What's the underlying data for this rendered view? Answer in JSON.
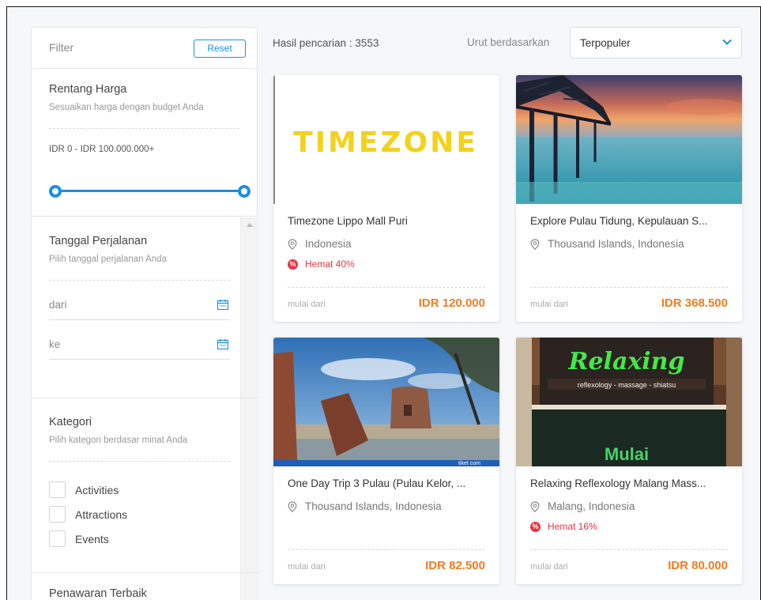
{
  "sidebar": {
    "filter_title": "Filter",
    "reset_label": "Reset",
    "price": {
      "title": "Rentang Harga",
      "subtitle": "Sesuaikan harga dengan budget Anda",
      "range_text": "IDR 0 - IDR 100.000.000+",
      "slider_min_fraction": 0,
      "slider_max_fraction": 1
    },
    "date": {
      "title": "Tanggal Perjalanan",
      "subtitle": "Pilih tanggal perjalanan Anda",
      "from_placeholder": "dari",
      "to_placeholder": "ke"
    },
    "category": {
      "title": "Kategori",
      "subtitle": "Pilih kategori berdasar minat Anda",
      "items": [
        {
          "label": "Activities",
          "checked": false
        },
        {
          "label": "Attractions",
          "checked": false
        },
        {
          "label": "Events",
          "checked": false
        }
      ]
    },
    "best_offer_title": "Penawaran Terbaik"
  },
  "results": {
    "label": "Hasil pencarian : 3553",
    "sort_label": "Urut berdasarkan",
    "sort_value": "Terpopuler"
  },
  "cards": [
    {
      "title": "Timezone Lippo Mall Puri",
      "location": "Indonesia",
      "discount": "Hemat 40%",
      "from_label": "mulai dari",
      "price": "IDR 120.000",
      "image": "timezone-logo",
      "logo_text": "TIMEZONE"
    },
    {
      "title": "Explore Pulau Tidung, Kepulauan S...",
      "location": "Thousand Islands, Indonesia",
      "discount": "",
      "from_label": "mulai dari",
      "price": "IDR 368.500",
      "image": "bridge-sunset-photo"
    },
    {
      "title": "One Day Trip 3 Pulau (Pulau Kelor, ...",
      "location": "Thousand Islands, Indonesia",
      "discount": "",
      "from_label": "mulai dari",
      "price": "IDR 82.500",
      "image": "fort-ruins-photo",
      "watermark": "tiket com"
    },
    {
      "title": "Relaxing Reflexology Malang Mass...",
      "location": "Malang, Indonesia",
      "discount": "Hemat 16%",
      "from_label": "mulai dari",
      "price": "IDR 80.000",
      "image": "spa-storefront-photo",
      "sign_text": "Relaxing",
      "sign_sub": "reflexology - massage - shiatsu",
      "sign_low": "Mulai"
    }
  ],
  "colors": {
    "accent": "#1a8fe3",
    "price": "#f47b20",
    "discount": "#e8323e"
  }
}
